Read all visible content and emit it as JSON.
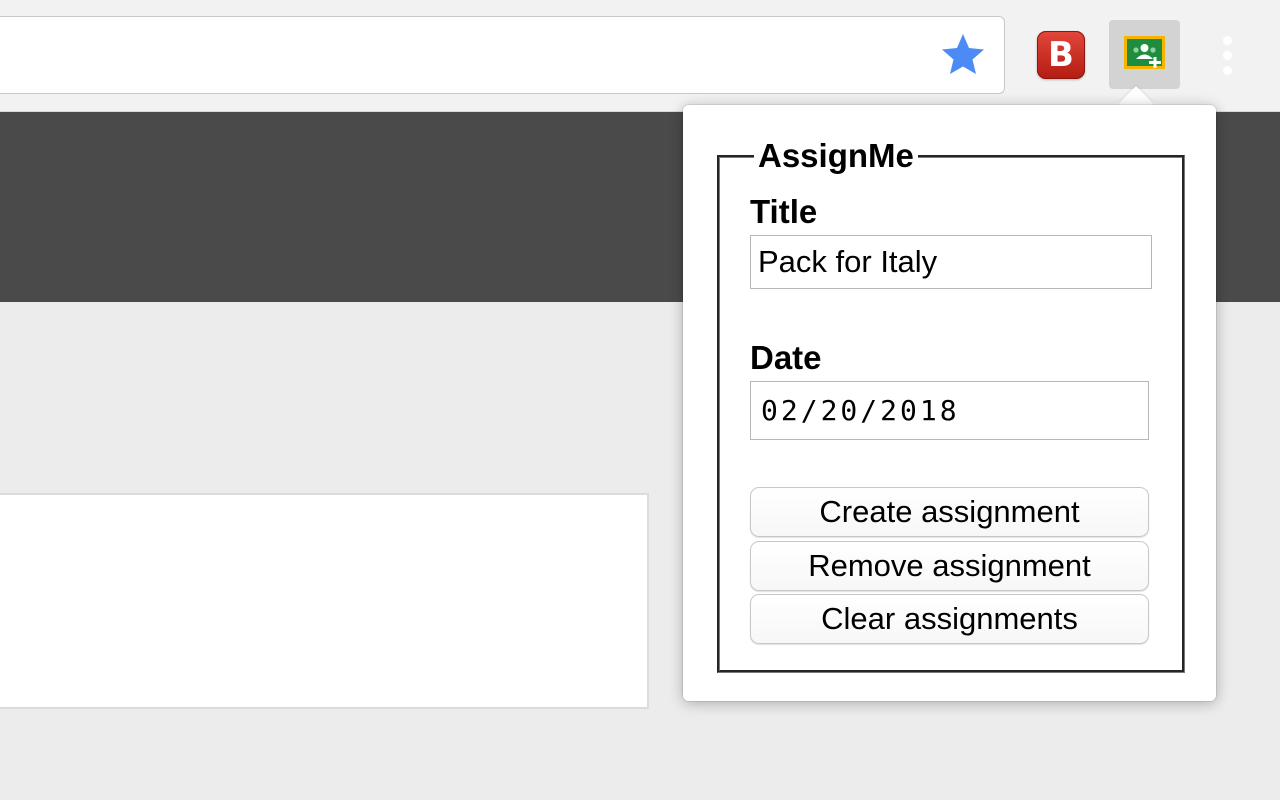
{
  "toolbar": {
    "omnibox_text": "",
    "icons": {
      "bookmark": "star-icon",
      "extension_b": "b-extension-icon",
      "extension_classroom": "google-classroom-icon",
      "menu": "vertical-dots-icon"
    },
    "extension_b_letter": "B",
    "colors": {
      "star": "#4c8bf5",
      "b_badge": "#d32f22",
      "classroom_green": "#1e8e3e",
      "classroom_yellow": "#f4b400"
    }
  },
  "popup": {
    "legend": "AssignMe",
    "title_label": "Title",
    "title_value": "Pack for Italy",
    "date_label": "Date",
    "date_value": "02/20/2018",
    "buttons": {
      "create": "Create assignment",
      "remove": "Remove assignment",
      "clear": "Clear assignments"
    }
  },
  "page": {
    "colors": {
      "dark_band": "#4a4a4a",
      "background": "#ececec"
    }
  }
}
